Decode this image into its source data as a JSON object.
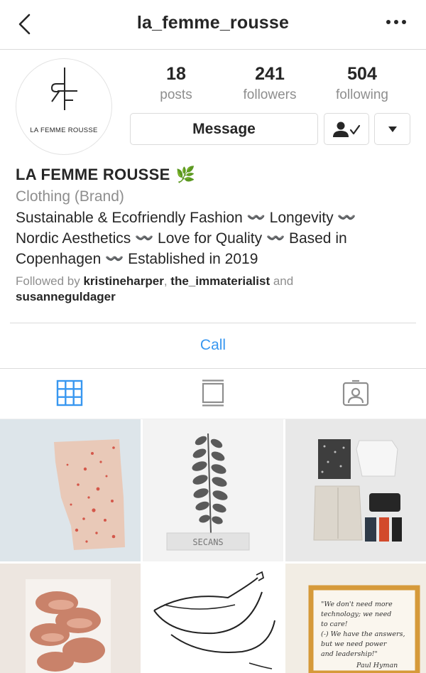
{
  "header": {
    "username": "la_femme_rousse"
  },
  "profile": {
    "avatar_text": "LA FEMME ROUSSE",
    "stats": [
      {
        "value": "18",
        "label": "posts"
      },
      {
        "value": "241",
        "label": "followers"
      },
      {
        "value": "504",
        "label": "following"
      }
    ],
    "message_label": "Message"
  },
  "bio": {
    "name": "LA FEMME ROUSSE",
    "emoji": "🌿",
    "category": "Clothing (Brand)",
    "lines": [
      "Sustainable & Ecofriendly Fashion 〰️ Longevity 〰️",
      "Nordic Aesthetics 〰️ Love for Quality 〰️ Based in",
      "Copenhagen 〰️ Established in 2019"
    ],
    "followed_prefix": "Followed by ",
    "followed_user1": "kristineharper",
    "followed_sep": ", ",
    "followed_user2": "the_immaterialist",
    "followed_and": " and",
    "followed_user3": "susanneguldager"
  },
  "actions": {
    "call_label": "Call"
  },
  "posts": {
    "sticker_text": "SECANS",
    "quote_lines": [
      "\"We don't need more",
      "technology; we need",
      "to care!",
      "(-) We have the answers,",
      "but we need power",
      "and leadership!\"",
      "Paul Hyman"
    ]
  },
  "colors": {
    "link_blue": "#3897f0",
    "border": "#dbdbdb",
    "secondary_text": "#8e8e8e"
  }
}
